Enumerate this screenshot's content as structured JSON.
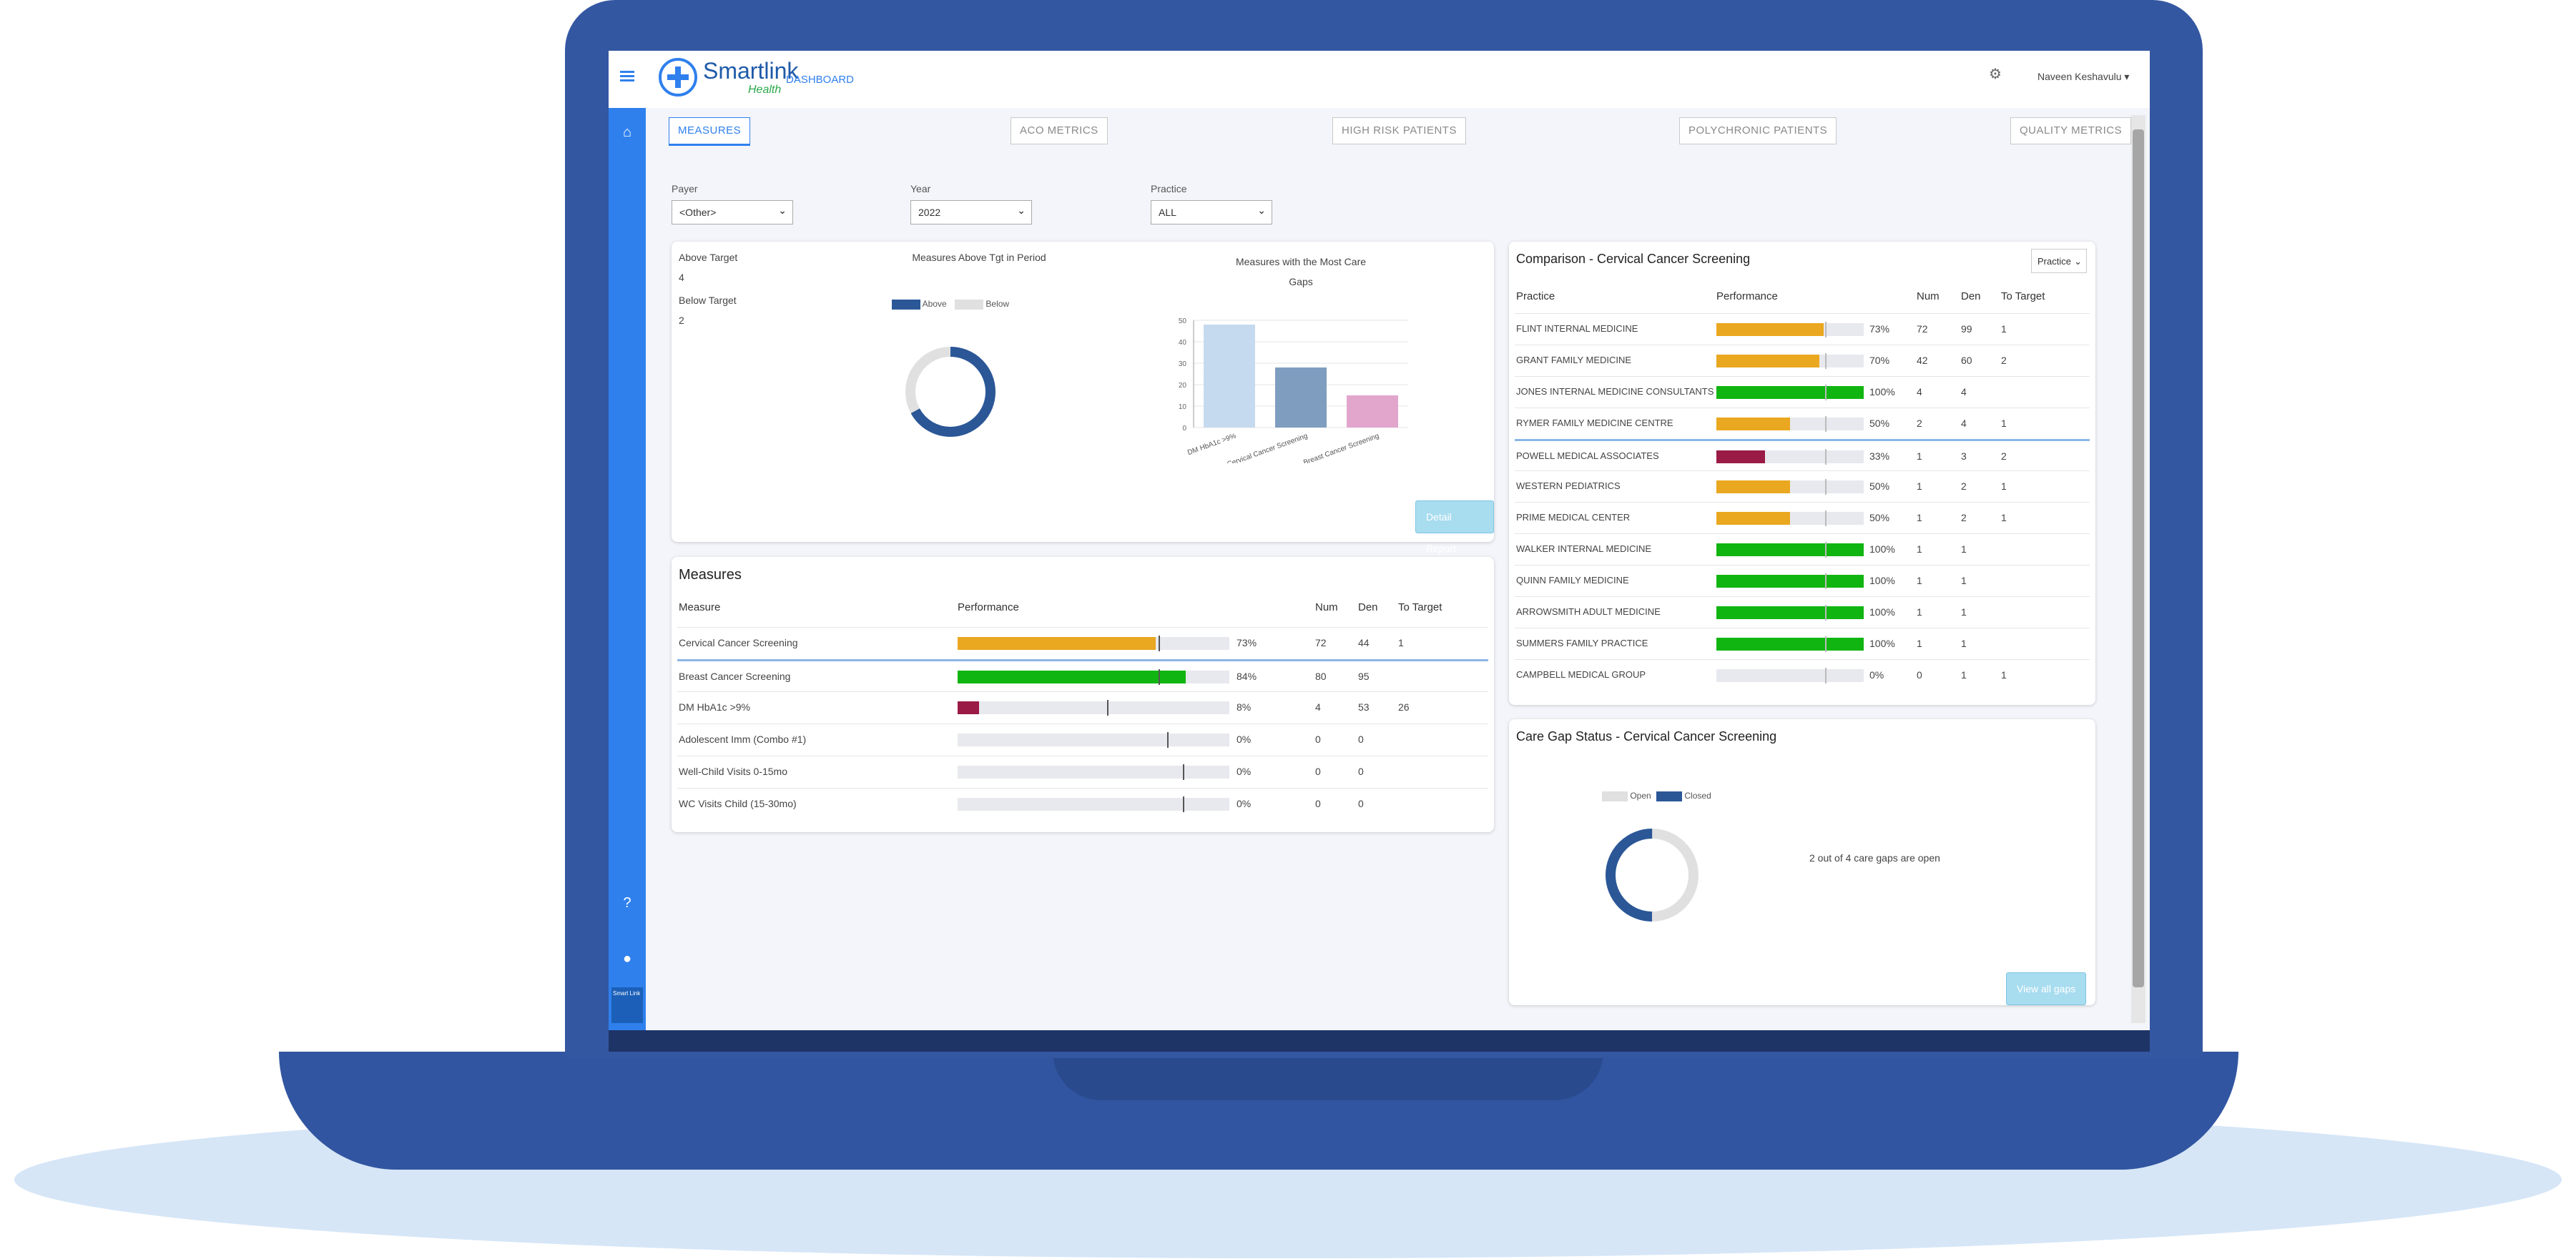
{
  "app": {
    "logo_primary": "Smartlink",
    "logo_secondary": "Health",
    "header_link": "DASHBOARD",
    "user_name": "Naveen Keshavulu",
    "user_caret": "▾"
  },
  "sidebar": {
    "logo_text": "Smart Link"
  },
  "tabs": [
    "MEASURES",
    "ACO METRICS",
    "HIGH RISK PATIENTS",
    "POLYCHRONIC PATIENTS",
    "QUALITY METRICS"
  ],
  "filters": [
    {
      "label": "Payer",
      "value": "<Other>"
    },
    {
      "label": "Year",
      "value": "2022"
    },
    {
      "label": "Practice",
      "value": "ALL"
    }
  ],
  "summary": {
    "above_label": "Above Target",
    "above_value": "4",
    "below_label": "Below Target",
    "below_value": "2",
    "donut_title": "Measures Above Tgt in Period",
    "legend": [
      "Above",
      "Below"
    ],
    "donut_above_fraction": 0.67,
    "bar_title": "Measures with the Most Care Gaps",
    "detail_button": "Detail Report"
  },
  "chart_data": {
    "type": "bar",
    "title": "Measures with the Most Care Gaps",
    "categories": [
      "DM HbA1c >9%",
      "Cervical Cancer Screening",
      "Breast Cancer Screening"
    ],
    "values": [
      48,
      28,
      15
    ],
    "ylim": [
      0,
      50
    ],
    "yticks": [
      "50",
      "40",
      "30",
      "20",
      "10",
      "0"
    ],
    "colors": [
      "#c5daef",
      "#7f9dbf",
      "#e2a6cd"
    ]
  },
  "measures": {
    "title": "Measures",
    "headers": {
      "measure": "Measure",
      "performance": "Performance",
      "num": "Num",
      "den": "Den",
      "to_target": "To Target"
    },
    "rows": [
      {
        "name": "Cervical Cancer Screening",
        "pct": "73%",
        "fill": 0.73,
        "target": 0.74,
        "color": "#eaa720",
        "num": "72",
        "den": "44",
        "to_target": "1"
      },
      {
        "name": "Breast Cancer Screening",
        "pct": "84%",
        "fill": 0.84,
        "target": 0.74,
        "color": "#11b511",
        "num": "80",
        "den": "95",
        "to_target": ""
      },
      {
        "name": "DM HbA1c >9%",
        "pct": "8%",
        "fill": 0.08,
        "target": 0.55,
        "color": "#9a1b45",
        "num": "4",
        "den": "53",
        "to_target": "26"
      },
      {
        "name": "Adolescent Imm (Combo #1)",
        "pct": "0%",
        "fill": 0,
        "target": 0.77,
        "color": "#11b511",
        "num": "0",
        "den": "0",
        "to_target": ""
      },
      {
        "name": "Well-Child Visits 0-15mo",
        "pct": "0%",
        "fill": 0,
        "target": 0.83,
        "color": "#11b511",
        "num": "0",
        "den": "0",
        "to_target": ""
      },
      {
        "name": "WC Visits Child (15-30mo)",
        "pct": "0%",
        "fill": 0,
        "target": 0.83,
        "color": "#11b511",
        "num": "0",
        "den": "0",
        "to_target": ""
      }
    ]
  },
  "comparison": {
    "title": "Comparison - Cervical Cancer Screening",
    "dropdown": "Practice",
    "headers": {
      "practice": "Practice",
      "performance": "Performance",
      "num": "Num",
      "den": "Den",
      "to_target": "To Target"
    },
    "rows": [
      {
        "name": "FLINT INTERNAL MEDICINE",
        "pct": "73%",
        "fill": 0.73,
        "color": "#eaa720",
        "num": "72",
        "den": "99",
        "to_target": "1"
      },
      {
        "name": "GRANT FAMILY MEDICINE",
        "pct": "70%",
        "fill": 0.7,
        "color": "#eaa720",
        "num": "42",
        "den": "60",
        "to_target": "2"
      },
      {
        "name": "JONES INTERNAL MEDICINE CONSULTANTS",
        "pct": "100%",
        "fill": 1.0,
        "color": "#11b511",
        "num": "4",
        "den": "4",
        "to_target": ""
      },
      {
        "name": "RYMER FAMILY MEDICINE CENTRE",
        "pct": "50%",
        "fill": 0.5,
        "color": "#eaa720",
        "num": "2",
        "den": "4",
        "to_target": "1"
      },
      {
        "name": "POWELL MEDICAL ASSOCIATES",
        "pct": "33%",
        "fill": 0.33,
        "color": "#9a1b45",
        "num": "1",
        "den": "3",
        "to_target": "2"
      },
      {
        "name": "WESTERN PEDIATRICS",
        "pct": "50%",
        "fill": 0.5,
        "color": "#eaa720",
        "num": "1",
        "den": "2",
        "to_target": "1"
      },
      {
        "name": "PRIME MEDICAL CENTER",
        "pct": "50%",
        "fill": 0.5,
        "color": "#eaa720",
        "num": "1",
        "den": "2",
        "to_target": "1"
      },
      {
        "name": "WALKER INTERNAL MEDICINE",
        "pct": "100%",
        "fill": 1.0,
        "color": "#11b511",
        "num": "1",
        "den": "1",
        "to_target": ""
      },
      {
        "name": "QUINN FAMILY MEDICINE",
        "pct": "100%",
        "fill": 1.0,
        "color": "#11b511",
        "num": "1",
        "den": "1",
        "to_target": ""
      },
      {
        "name": "ARROWSMITH ADULT MEDICINE",
        "pct": "100%",
        "fill": 1.0,
        "color": "#11b511",
        "num": "1",
        "den": "1",
        "to_target": ""
      },
      {
        "name": "SUMMERS FAMILY PRACTICE",
        "pct": "100%",
        "fill": 1.0,
        "color": "#11b511",
        "num": "1",
        "den": "1",
        "to_target": ""
      },
      {
        "name": "CAMPBELL MEDICAL GROUP",
        "pct": "0%",
        "fill": 0,
        "color": "#11b511",
        "num": "0",
        "den": "1",
        "to_target": "1"
      }
    ]
  },
  "caregap": {
    "title": "Care Gap Status - Cervical Cancer Screening",
    "legend": [
      "Open",
      "Closed"
    ],
    "closed_fraction": 0.5,
    "message": "2 out of 4 care gaps are open",
    "button": "View all gaps"
  },
  "colors": {
    "primary": "#2f80ed",
    "dark_blue": "#2b5797",
    "grey": "#e0e0e0"
  }
}
